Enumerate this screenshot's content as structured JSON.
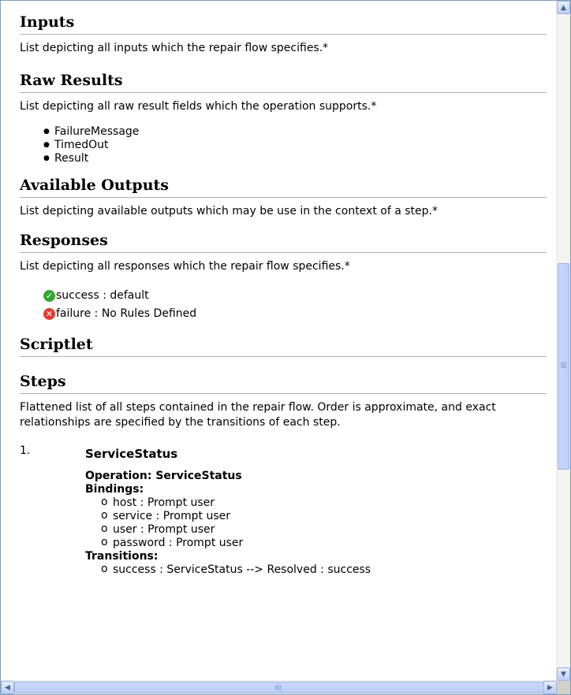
{
  "sections": {
    "inputs": {
      "title": "Inputs",
      "desc": "List depicting all inputs which the repair flow specifies.*"
    },
    "raw_results": {
      "title": "Raw Results",
      "desc": "List depicting all raw result fields which the operation supports.*",
      "items": [
        "FailureMessage",
        "TimedOut",
        "Result"
      ]
    },
    "available_outputs": {
      "title": "Available Outputs",
      "desc": "List depicting available outputs which may be use in the context of a step.*"
    },
    "responses": {
      "title": "Responses",
      "desc": "List depicting all responses which the repair flow specifies.*",
      "items": [
        {
          "text": "success : default",
          "icon": "success-check-icon",
          "color": "#33a832"
        },
        {
          "text": "failure : No Rules Defined",
          "icon": "failure-x-icon",
          "color": "#e23c2e"
        }
      ]
    },
    "scriptlet": {
      "title": "Scriptlet"
    },
    "steps": {
      "title": "Steps",
      "desc": "Flattened list of all steps contained in the repair flow. Order is approximate, and exact relationships are specified by the transitions of each step.",
      "list": [
        {
          "number": "1.",
          "name": "ServiceStatus",
          "operation": "Operation: ServiceStatus",
          "bindings_label": "Bindings:",
          "bindings": [
            "host : Prompt user",
            "service : Prompt user",
            "user : Prompt user",
            "password : Prompt user"
          ],
          "transitions_label": "Transitions:",
          "transitions": [
            "success : ServiceStatus --> Resolved : success"
          ]
        }
      ]
    }
  },
  "scrollbars": {
    "up_arrow": "▲",
    "down_arrow": "▼",
    "left_arrow": "◀",
    "right_arrow": "▶"
  }
}
